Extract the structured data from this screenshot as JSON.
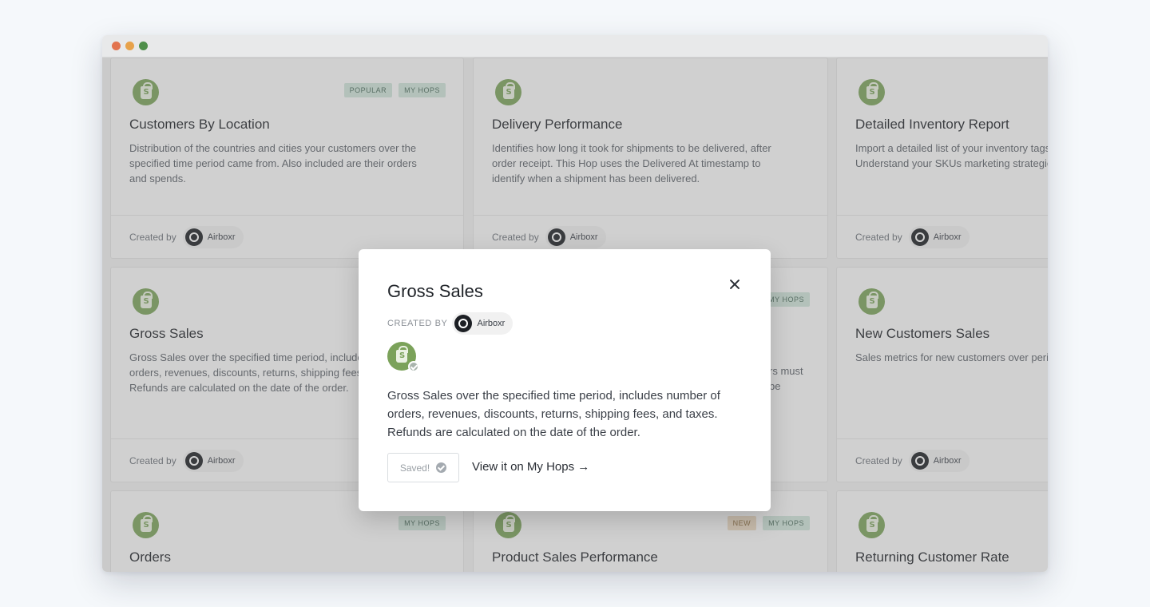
{
  "cards": [
    {
      "title": "Customers By Location",
      "desc": "Distribution of the countries and cities your customers over the specified time period came from. Also included are their orders and spends.",
      "tags": [
        "POPULAR",
        "MY HOPS"
      ],
      "created_label": "Created by",
      "author": "Airboxr"
    },
    {
      "title": "Delivery Performance",
      "desc": "Identifies how long it took for shipments to be delivered, after order receipt. This Hop uses the Delivered At timestamp to identify when a shipment has been delivered.",
      "tags": [],
      "created_label": "Created by",
      "author": "Airboxr"
    },
    {
      "title": "Detailed Inventory Report",
      "desc": "Import a detailed list of your inventory tags, and images. Understand your SKUs marketing strategies.",
      "tags": [],
      "created_label": "Created by",
      "author": "Airboxr"
    },
    {
      "title": "Gross Sales",
      "desc": "Gross Sales over the specified time period, includes number of orders, revenues, discounts, returns, shipping fees and taxes. Refunds are calculated on the date of the order.",
      "tags": [],
      "created_label": "Created by",
      "author": "Airboxr"
    },
    {
      "title": "",
      "desc": "rs must be",
      "tags": [
        "MY HOPS"
      ],
      "created_label": "",
      "author": ""
    },
    {
      "title": "New Customers Sales",
      "desc": "Sales metrics for new customers over period.",
      "tags": [],
      "created_label": "Created by",
      "author": "Airboxr"
    },
    {
      "title": "Orders",
      "desc": "",
      "tags": [
        "MY HOPS"
      ],
      "created_label": "",
      "author": ""
    },
    {
      "title": "Product Sales Performance",
      "desc": "",
      "tags": [
        "NEW",
        "MY HOPS"
      ],
      "created_label": "",
      "author": ""
    },
    {
      "title": "Returning Customer Rate",
      "desc": "",
      "tags": [],
      "created_label": "",
      "author": ""
    }
  ],
  "modal": {
    "title": "Gross Sales",
    "created_label": "CREATED BY",
    "author": "Airboxr",
    "description": "Gross Sales over the specified time period, includes number of orders, revenues, discounts, returns, shipping fees, and taxes. Refunds are calculated on the date of the order.",
    "saved_label": "Saved!",
    "view_link": "View it on My Hops →"
  },
  "colors": {
    "brand_green": "#7ba25a",
    "tag_bg": "#cfe4d9",
    "author_logo": "#1c1f24"
  },
  "icons": {
    "card_icon": "shopify-bag-icon",
    "close": "close-icon",
    "check": "check-circle-icon",
    "author": "airboxr-logo-icon"
  }
}
